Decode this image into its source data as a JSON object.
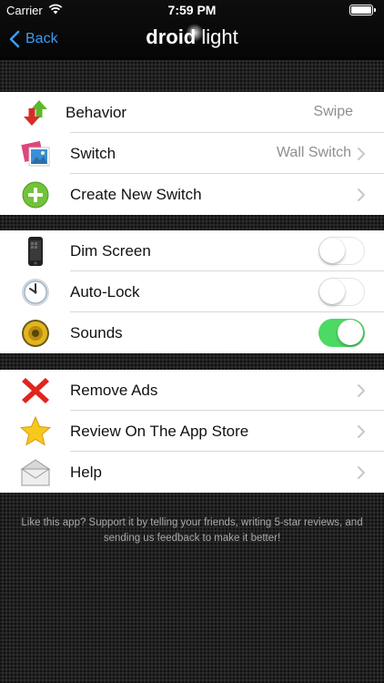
{
  "status_bar": {
    "carrier": "Carrier",
    "time": "7:59 PM"
  },
  "nav": {
    "back_label": "Back",
    "logo_bold": "droid",
    "logo_light": " light"
  },
  "sections": [
    {
      "rows": [
        {
          "label": "Behavior",
          "value": "Swipe",
          "icon": "up-down-arrows-icon"
        },
        {
          "label": "Switch",
          "value": "Wall Switch",
          "icon": "photos-icon"
        },
        {
          "label": "Create New Switch",
          "value": "",
          "icon": "green-plus-icon"
        }
      ]
    },
    {
      "rows": [
        {
          "label": "Dim Screen",
          "toggle": false,
          "icon": "phone-icon"
        },
        {
          "label": "Auto-Lock",
          "toggle": false,
          "icon": "clock-icon"
        },
        {
          "label": "Sounds",
          "toggle": true,
          "icon": "speaker-icon"
        }
      ]
    },
    {
      "rows": [
        {
          "label": "Remove Ads",
          "icon": "red-x-icon"
        },
        {
          "label": "Review On The App Store",
          "icon": "star-icon"
        },
        {
          "label": "Help",
          "icon": "envelope-icon"
        }
      ]
    }
  ],
  "footer_text": "Like this app? Support it by telling your friends, writing 5-star reviews, and sending us feedback to make it better!",
  "colors": {
    "accent": "#3a9cf6",
    "toggle_on": "#4cd964"
  }
}
